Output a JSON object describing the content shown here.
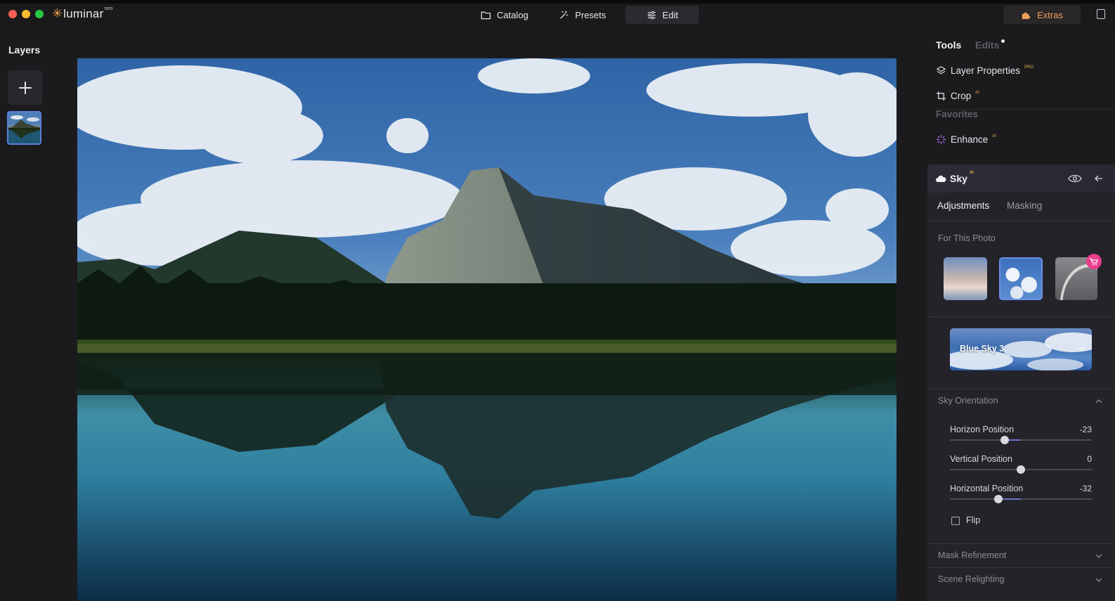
{
  "app": {
    "name": "luminar",
    "name_suffix": "neo"
  },
  "nav": {
    "catalog": "Catalog",
    "presets": "Presets",
    "edit": "Edit",
    "extras": "Extras"
  },
  "layers": {
    "title": "Layers"
  },
  "panel": {
    "tabs": {
      "tools": "Tools",
      "edits": "Edits"
    },
    "tools": [
      {
        "label": "Layer Properties",
        "badge": "PRO",
        "icon": "layers-icon"
      },
      {
        "label": "Crop",
        "badge": "AI",
        "icon": "crop-icon"
      }
    ],
    "favorites_label": "Favorites",
    "favorites": [
      {
        "label": "Enhance",
        "badge": "AI",
        "icon": "sparkle-icon"
      }
    ],
    "sky": {
      "title": "Sky",
      "badge": "AI",
      "subtabs": {
        "adjustments": "Adjustments",
        "masking": "Masking"
      },
      "for_this_photo": "For This Photo",
      "selected_sky": "Blue Sky 3",
      "orientation_label": "Sky Orientation",
      "sliders": [
        {
          "label": "Horizon Position",
          "value": "-23",
          "norm": 0.385
        },
        {
          "label": "Vertical Position",
          "value": "0",
          "norm": 0.5
        },
        {
          "label": "Horizontal Position",
          "value": "-32",
          "norm": 0.34
        }
      ],
      "flip_label": "Flip",
      "mask_refinement": "Mask Refinement",
      "scene_relighting": "Scene Relighting"
    }
  },
  "colors": {
    "accent": "#6a73c8",
    "extras": "#f0a05a",
    "badge": "#e8b050",
    "selection": "#5b7fd8"
  }
}
